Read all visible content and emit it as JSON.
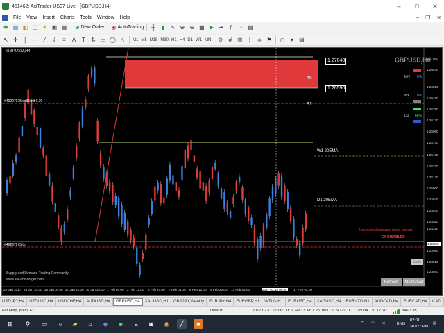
{
  "window": {
    "title": "451462: AxiTrader-US07-Live - [GBPUSD,H4]"
  },
  "menu": [
    "File",
    "View",
    "Insert",
    "Charts",
    "Tools",
    "Window",
    "Help"
  ],
  "toolbar": {
    "new_order": "New Order",
    "auto_trading": "AutoTrading",
    "timeframes": [
      "M1",
      "M5",
      "M15",
      "M30",
      "H1",
      "H4",
      "D1",
      "W1",
      "MN"
    ]
  },
  "chart": {
    "label": "GBPUSD,H4",
    "symbol": "GBPUSD,H4",
    "panel": [
      {
        "label": "MN",
        "value": "0%",
        "color": "#4aa3ff"
      },
      {
        "label": "WK",
        "value": "0%",
        "color": "#4aa3ff"
      },
      {
        "label": "D1",
        "value": "66%",
        "color": "#4adf7a"
      }
    ],
    "zone_value": "45",
    "zone_side_value": "91",
    "price_box_top": "1.27040",
    "price_box_bottom": "1.26590",
    "sell_limit_label": "#46297975 sell limit 0.30",
    "tp_label": "#46297975 tp",
    "w1_ema_label": "W1 20EMA",
    "d1_ema_label": "D1 20EMA",
    "warning_1": "Username/password is not correct.",
    "warning_2": "EA DISABLED",
    "footer_1": "Supply and Demand Trading Community",
    "footer_2": "www.set-and-forget.com",
    "refresh_button": "Refresh",
    "multichart_button": "MultiChart",
    "scale_button": "Scale",
    "colors": {
      "zone": "#e0393b",
      "bull": "#3b7fe0",
      "bear": "#e03b3b",
      "ema_w1": "#b8d86a",
      "ema_d1": "#ffffff"
    },
    "y_labels": [
      "1.27040",
      "1.26870",
      "1.26590",
      "1.26450",
      "1.26280",
      "1.26120",
      "1.25960",
      "1.25700",
      "1.25490",
      "1.25330",
      "1.25170",
      "1.25000",
      "1.24840",
      "1.24670",
      "1.24510",
      "1.24310",
      "1.24063",
      "1.23980",
      "1.23810",
      "1.23640"
    ],
    "y_highlight": "1.24063",
    "x_labels": [
      "23 Jan 2017",
      "24 Jan 20:00",
      "26 Jan 04:00",
      "27 Jan 12:00",
      "30 Jan 20:00",
      "1 Feb 04:00",
      "2 Feb 12:00",
      "3 Feb 20:00",
      "7 Feb 04:00",
      "8 Feb 12:00",
      "9 Feb 20:00",
      "13 Feb 04:00",
      "2017.02.14 08:00",
      "17 Feb 04:00"
    ],
    "x_highlight": "2017.02.14 08:00"
  },
  "tabs": [
    "USDJPY,H4",
    "NZDUSD,H4",
    "USDCHF,H4",
    "AUDUSD,H4",
    "GBPUSD,H4",
    "XAUUSD,H1",
    "GBPJPY,Weekly",
    "EURJPY,H4",
    "EURGBP,H1",
    "WTI.fs,H1",
    "EURUSD,H4",
    "XAGUSD,H4",
    "EURNZD,H1",
    "AUDCAD,H4",
    "EURCAD,H4",
    "CAD"
  ],
  "active_tab": "GBPUSD,H4",
  "status": {
    "help": "For Help, press F1",
    "profile": "Default",
    "datetime": "2017.02.17 00:00",
    "open": "O: 1.24813",
    "high": "H: 1.25100",
    "low": "L: 1.24779",
    "close": "C: 1.25034",
    "volume": "V: 12747",
    "traffic": "346/3 kb"
  },
  "taskbar": {
    "lang": "ENG",
    "time": "02:01",
    "day": "THU/27 PM"
  }
}
